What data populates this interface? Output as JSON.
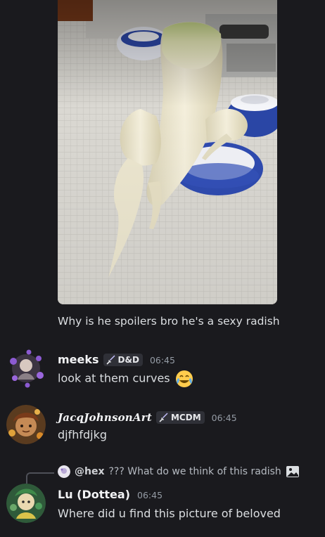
{
  "attachment": {
    "caption": "Why is he spoilers bro he's a sexy radish"
  },
  "messages": [
    {
      "username": "meeks",
      "tag": "D&D",
      "time": "06:45",
      "text": "look at them curves",
      "emoji": "joy-emoji"
    },
    {
      "username": "JacqJohnsonArt",
      "tag": "MCDM",
      "time": "06:45",
      "text": "djfhfdjkg"
    },
    {
      "reply": {
        "user": "@hex",
        "text": "??? What do we think of this radish"
      },
      "username": "Lu (Dottea)",
      "time": "06:45",
      "text": "Where did u find this picture of beloved"
    }
  ],
  "colors": {
    "background": "#1a1a1e",
    "text": "#dbdee1",
    "muted": "#949ba4",
    "tag_bg": "#2f3037"
  }
}
